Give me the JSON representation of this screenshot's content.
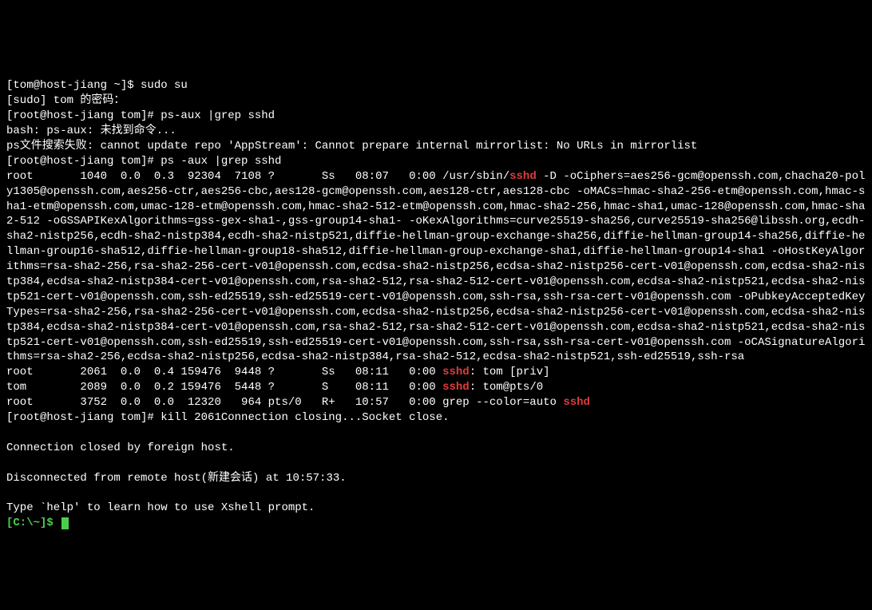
{
  "lines": {
    "l1": "[tom@host-jiang ~]$ sudo su",
    "l2": "[sudo] tom 的密码：",
    "l3": "[root@host-jiang tom]# ps-aux |grep sshd",
    "l4": "bash: ps-aux: 未找到命令...",
    "l5": "ps文件搜索失败: cannot update repo 'AppStream': Cannot prepare internal mirrorlist: No URLs in mirrorlist",
    "l6": "[root@host-jiang tom]# ps -aux |grep sshd",
    "l7a": "root       1040  0.0  0.3  92304  7108 ?       Ss   08:07   0:00 /usr/sbin/",
    "l7b": "sshd",
    "l7c": " -D -oCiphers=aes256-gcm@openssh.com,chacha20-poly1305@openssh.com,aes256-ctr,aes256-cbc,aes128-gcm@openssh.com,aes128-ctr,aes128-cbc -oMACs=hmac-sha2-256-etm@openssh.com,hmac-sha1-etm@openssh.com,umac-128-etm@openssh.com,hmac-sha2-512-etm@openssh.com,hmac-sha2-256,hmac-sha1,umac-128@openssh.com,hmac-sha2-512 -oGSSAPIKexAlgorithms=gss-gex-sha1-,gss-group14-sha1- -oKexAlgorithms=curve25519-sha256,curve25519-sha256@libssh.org,ecdh-sha2-nistp256,ecdh-sha2-nistp384,ecdh-sha2-nistp521,diffie-hellman-group-exchange-sha256,diffie-hellman-group14-sha256,diffie-hellman-group16-sha512,diffie-hellman-group18-sha512,diffie-hellman-group-exchange-sha1,diffie-hellman-group14-sha1 -oHostKeyAlgorithms=rsa-sha2-256,rsa-sha2-256-cert-v01@openssh.com,ecdsa-sha2-nistp256,ecdsa-sha2-nistp256-cert-v01@openssh.com,ecdsa-sha2-nistp384,ecdsa-sha2-nistp384-cert-v01@openssh.com,rsa-sha2-512,rsa-sha2-512-cert-v01@openssh.com,ecdsa-sha2-nistp521,ecdsa-sha2-nistp521-cert-v01@openssh.com,ssh-ed25519,ssh-ed25519-cert-v01@openssh.com,ssh-rsa,ssh-rsa-cert-v01@openssh.com -oPubkeyAcceptedKeyTypes=rsa-sha2-256,rsa-sha2-256-cert-v01@openssh.com,ecdsa-sha2-nistp256,ecdsa-sha2-nistp256-cert-v01@openssh.com,ecdsa-sha2-nistp384,ecdsa-sha2-nistp384-cert-v01@openssh.com,rsa-sha2-512,rsa-sha2-512-cert-v01@openssh.com,ecdsa-sha2-nistp521,ecdsa-sha2-nistp521-cert-v01@openssh.com,ssh-ed25519,ssh-ed25519-cert-v01@openssh.com,ssh-rsa,ssh-rsa-cert-v01@openssh.com -oCASignatureAlgorithms=rsa-sha2-256,ecdsa-sha2-nistp256,ecdsa-sha2-nistp384,rsa-sha2-512,ecdsa-sha2-nistp521,ssh-ed25519,ssh-rsa",
    "l8a": "root       2061  0.0  0.4 159476  9448 ?       Ss   08:11   0:00 ",
    "l8b": "sshd",
    "l8c": ": tom [priv]",
    "l9a": "tom        2089  0.0  0.2 159476  5448 ?       S    08:11   0:00 ",
    "l9b": "sshd",
    "l9c": ": tom@pts/0",
    "l10a": "root       3752  0.0  0.0  12320   964 pts/0   R+   10:57   0:00 grep --color=auto ",
    "l10b": "sshd",
    "l11": "[root@host-jiang tom]# kill 2061Connection closing...Socket close.",
    "l12": "",
    "l13": "Connection closed by foreign host.",
    "l14": "",
    "l15": "Disconnected from remote host(新建会话) at 10:57:33.",
    "l16": "",
    "l17": "Type `help' to learn how to use Xshell prompt.",
    "l18": "[C:\\~]$ "
  }
}
